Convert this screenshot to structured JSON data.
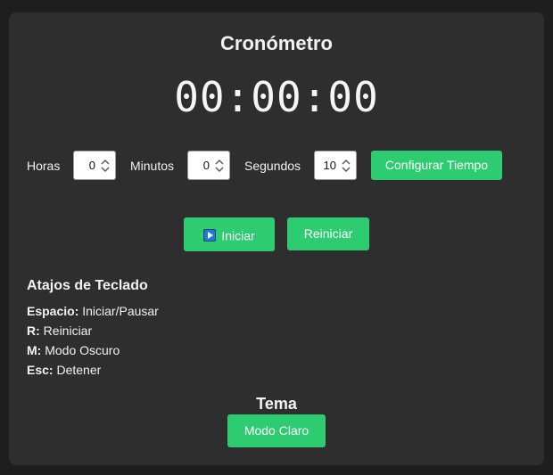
{
  "title": "Cronómetro",
  "display": "00:00:00",
  "time_inputs": {
    "hours_label": "Horas",
    "hours_value": "0",
    "minutes_label": "Minutos",
    "minutes_value": "0",
    "seconds_label": "Segundos",
    "seconds_value": "10",
    "set_button": "Configurar Tiempo"
  },
  "controls": {
    "start_button": "Iniciar",
    "start_icon": "play-icon",
    "reset_button": "Reiniciar"
  },
  "shortcuts": {
    "title": "Atajos de Teclado",
    "items": [
      {
        "key": "Espacio:",
        "action": "Iniciar/Pausar"
      },
      {
        "key": "R:",
        "action": "Reiniciar"
      },
      {
        "key": "M:",
        "action": "Modo Oscuro"
      },
      {
        "key": "Esc:",
        "action": "Detener"
      }
    ]
  },
  "theme": {
    "title": "Tema",
    "button": "Modo Claro"
  },
  "colors": {
    "background": "#1e1e1e",
    "card": "#2e2e2e",
    "accent": "#2ecc71"
  }
}
